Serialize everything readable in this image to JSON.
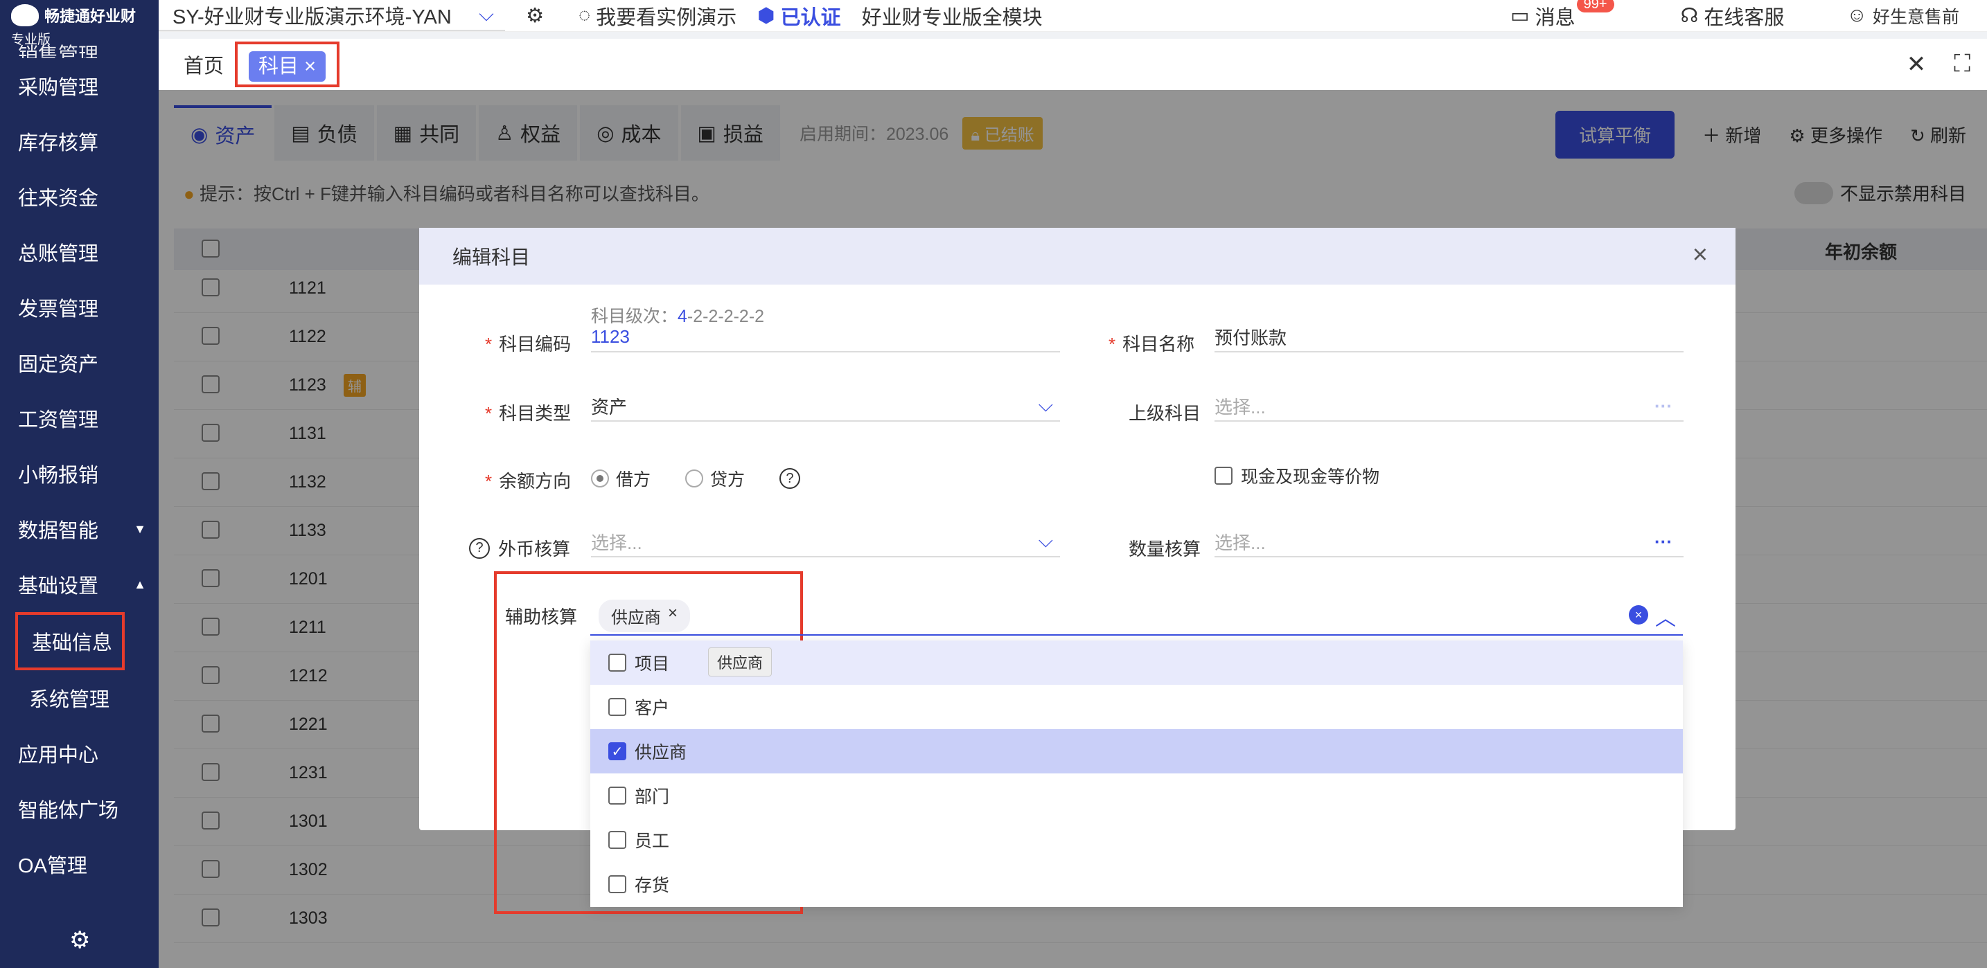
{
  "sidebar": {
    "brand": "畅捷通好业财",
    "edition": "专业版",
    "items": [
      {
        "label": "采购管理"
      },
      {
        "label": "库存核算"
      },
      {
        "label": "往来资金"
      },
      {
        "label": "总账管理"
      },
      {
        "label": "发票管理"
      },
      {
        "label": "固定资产"
      },
      {
        "label": "工资管理"
      },
      {
        "label": "小畅报销"
      },
      {
        "label": "数据智能"
      },
      {
        "label": "基础设置"
      },
      {
        "label": "基础信息"
      },
      {
        "label": "系统管理"
      },
      {
        "label": "应用中心"
      },
      {
        "label": "智能体广场"
      },
      {
        "label": "OA管理"
      }
    ],
    "partial_top": "销售管理"
  },
  "topbar": {
    "env": "SY-好业财专业版演示环境-YAN",
    "demo": "我要看实例演示",
    "verified": "已认证",
    "modules": "好业财专业版全模块",
    "messages": "消息",
    "msg_badge": "99+",
    "service": "在线客服",
    "user": "好生意售前"
  },
  "tabs": {
    "home": "首页",
    "active": "科目"
  },
  "categories": [
    "资产",
    "负债",
    "共同",
    "权益",
    "成本",
    "损益"
  ],
  "period": "启用期间：2023.06",
  "closed": "已结账",
  "actions": {
    "trial": "试算平衡",
    "add": "新增",
    "more": "更多操作",
    "refresh": "刷新"
  },
  "hint": "提示：按Ctrl + F键并输入科目编码或者科目名称可以查找科目。",
  "hide_disabled": "不显示禁用科目",
  "table": {
    "opening_balance_header": "年初余额",
    "aux_tag": "辅",
    "codes": [
      "1121",
      "1122",
      "1123",
      "1131",
      "1132",
      "1133",
      "1201",
      "1211",
      "1212",
      "1221",
      "1231",
      "1301",
      "1302",
      "1303"
    ]
  },
  "modal": {
    "title": "编辑科目",
    "level_label": "科目级次：",
    "level_value": "4",
    "level_rest": "-2-2-2-2-2",
    "code_label": "科目编码",
    "code_value": "1123",
    "name_label": "科目名称",
    "name_value": "预付账款",
    "type_label": "科目类型",
    "type_value": "资产",
    "parent_label": "上级科目",
    "parent_placeholder": "选择...",
    "direction_label": "余额方向",
    "debit": "借方",
    "credit": "贷方",
    "cash_equiv": "现金及现金等价物",
    "fx_label": "外币核算",
    "fx_placeholder": "选择...",
    "qty_label": "数量核算",
    "qty_placeholder": "选择...",
    "aux_label": "辅助核算",
    "aux_chip": "供应商",
    "tooltip": "供应商",
    "options": [
      {
        "label": "项目",
        "checked": false
      },
      {
        "label": "客户",
        "checked": false
      },
      {
        "label": "供应商",
        "checked": true
      },
      {
        "label": "部门",
        "checked": false
      },
      {
        "label": "员工",
        "checked": false
      },
      {
        "label": "存货",
        "checked": false
      }
    ]
  }
}
